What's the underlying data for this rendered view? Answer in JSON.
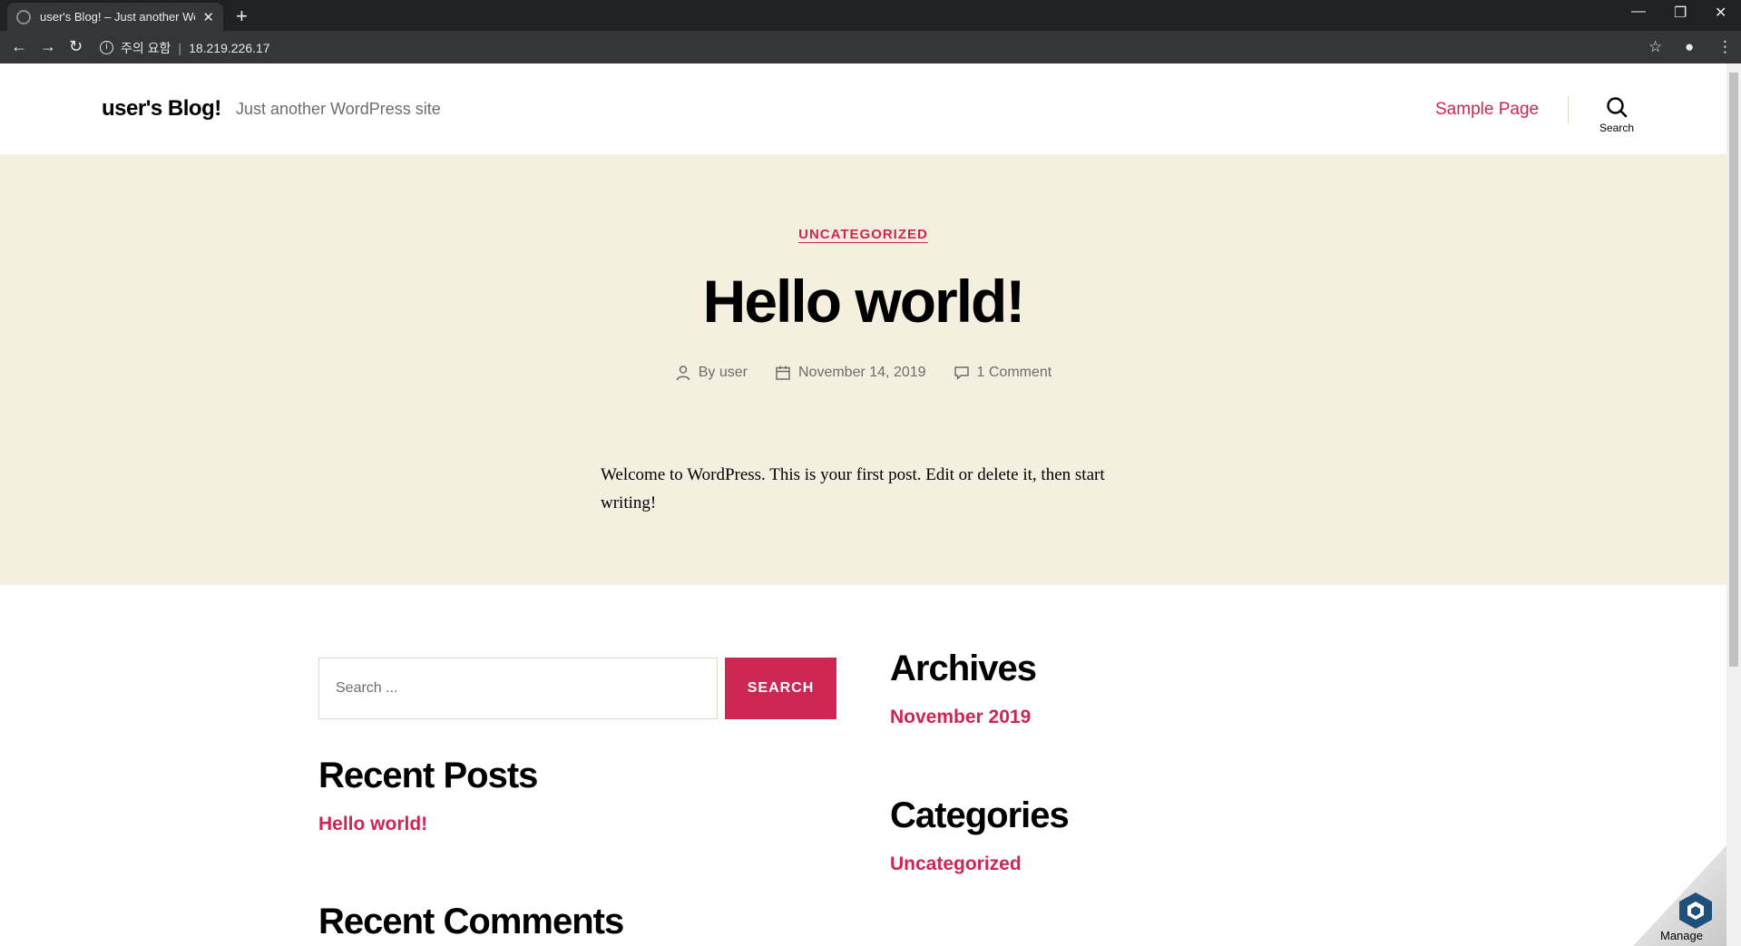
{
  "browser": {
    "tab_title": "user's Blog! – Just another Wor",
    "tab_close": "✕",
    "new_tab": "+",
    "security_label": "주의 요함",
    "url": "18.219.226.17"
  },
  "site": {
    "title": "user's Blog!",
    "description": "Just another WordPress site",
    "menu_item": "Sample Page",
    "search_label": "Search"
  },
  "post": {
    "category": "UNCATEGORIZED",
    "title": "Hello world!",
    "author": "By user",
    "date": "November 14, 2019",
    "comments": "1 Comment",
    "content": "Welcome to WordPress. This is your first post. Edit or delete it, then start writing!"
  },
  "widgets": {
    "search_placeholder": "Search ...",
    "search_button": "SEARCH",
    "recent_posts_heading": "Recent Posts",
    "recent_post_1": "Hello world!",
    "recent_comments_heading": "Recent Comments",
    "archives_heading": "Archives",
    "archive_1": "November 2019",
    "categories_heading": "Categories",
    "category_1": "Uncategorized"
  },
  "manage": {
    "label": "Manage"
  },
  "colors": {
    "accent": "#cd2653",
    "hero_bg": "#f5efe0",
    "chrome_dark": "#202124"
  }
}
